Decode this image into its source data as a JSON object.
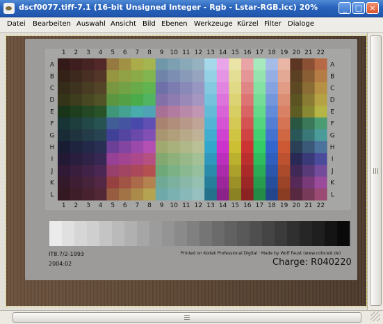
{
  "window": {
    "title": "dscf0077.tiff-7.1 (16-bit Unsigned Integer - Rgb - Lstar-RGB.icc) 20%",
    "buttons": {
      "minimize": "_",
      "maximize": "□",
      "close": "×"
    }
  },
  "menubar": {
    "items": [
      "Datei",
      "Bearbeiten",
      "Auswahl",
      "Ansicht",
      "Bild",
      "Ebenen",
      "Werkzeuge",
      "Kürzel",
      "Filter",
      "Dialoge"
    ]
  },
  "target": {
    "columns": [
      "1",
      "2",
      "3",
      "4",
      "5",
      "6",
      "7",
      "8",
      "9",
      "10",
      "11",
      "12",
      "13",
      "14",
      "15",
      "16",
      "17",
      "18",
      "19",
      "20",
      "21",
      "22"
    ],
    "rows": [
      "A",
      "B",
      "C",
      "D",
      "E",
      "F",
      "G",
      "H",
      "I",
      "J",
      "K",
      "L"
    ],
    "id_text": "IT8.7/2-1993",
    "date_text": "2004:02",
    "printed_text": "Printed on Kodak Professional Digital  ·  Made by Wolf Faust (www.coloraid.de)",
    "charge_text": "Charge: R040220"
  }
}
